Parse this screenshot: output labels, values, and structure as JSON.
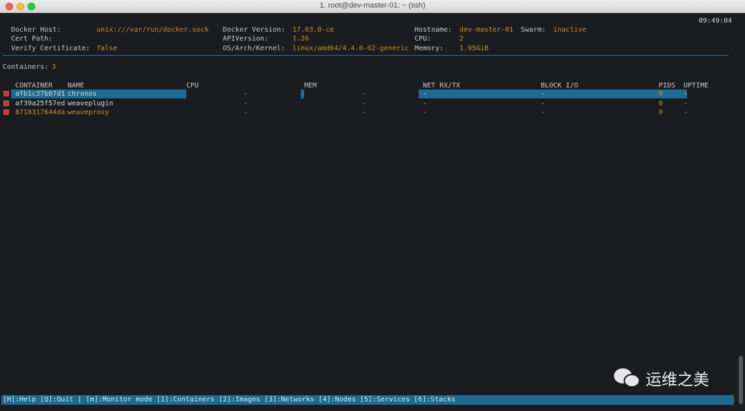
{
  "window": {
    "title": "1. root@dev-master-01: ~ (ssh)"
  },
  "clock": "09:49:04",
  "info": {
    "docker_host_label": "Docker Host:",
    "docker_host_value": "unix:///var/run/docker.sock",
    "cert_path_label": "Cert Path:",
    "verify_cert_label": "Verify Certificate:",
    "verify_cert_value": "false",
    "docker_version_label": "Docker Version:",
    "docker_version_value": "17.03.0-ce",
    "api_version_label": "APIVersion:",
    "api_version_value": "1.26",
    "os_label": "OS/Arch/Kernel:",
    "os_value": "linux/amd64/4.4.0-62-generic",
    "hostname_label": "Hostname:",
    "hostname_value": "dev-master-01",
    "swarm_label": "Swarm:",
    "swarm_value": "inactive",
    "cpu_label": "CPU:",
    "cpu_value": "2",
    "memory_label": "Memory:",
    "memory_value": "1.95GiB"
  },
  "containers_label": "Containers:",
  "containers_count": "3",
  "columns": {
    "container": "CONTAINER",
    "name": "NAME",
    "cpu": "CPU",
    "mem": "MEM",
    "net": "NET RX/TX",
    "block": "BLOCK I/O",
    "pids": "PIDS",
    "uptime": "UPTIME"
  },
  "rows": [
    {
      "id": "afb1c37b07d1",
      "name": "chronos",
      "cpu": "-",
      "mem": "-",
      "net": "-",
      "block": "-",
      "pids": "0",
      "uptime": "-"
    },
    {
      "id": "af39a25f57ed",
      "name": "weaveplugin",
      "cpu": "-",
      "mem": "-",
      "net": "-",
      "block": "-",
      "pids": "0",
      "uptime": "-"
    },
    {
      "id": "8718317644da",
      "name": "weaveproxy",
      "cpu": "-",
      "mem": "-",
      "net": "-",
      "block": "-",
      "pids": "0",
      "uptime": "-"
    }
  ],
  "footer": "[H]:Help [Q]:Quit | [m]:Monitor mode [1]:Containers [2]:Images [3]:Networks [4]:Nodes [5]:Services [6]:Stacks",
  "watermark": "运维之美",
  "colors": {
    "accent": "#1d6a92",
    "value": "#c8902c",
    "status_stopped": "#c03a2b"
  }
}
